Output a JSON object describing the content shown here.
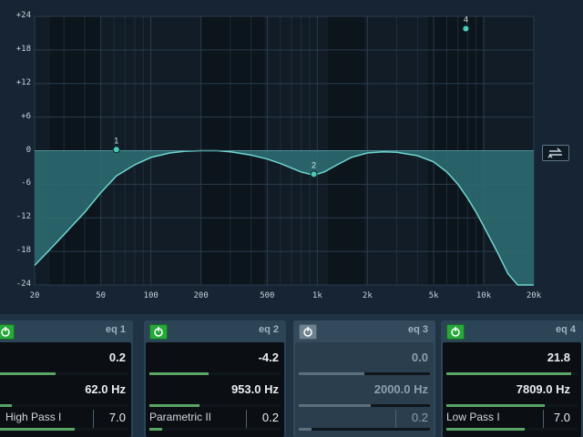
{
  "y_axis_labels": [
    "+24",
    "+18",
    "+12",
    "+6",
    "0",
    "-6",
    "-12",
    "-18",
    "-24"
  ],
  "x_axis_labels": [
    "20",
    "50",
    "100",
    "200",
    "500",
    "1k",
    "2k",
    "5k",
    "10k",
    "20k"
  ],
  "curve_points_db": [
    [
      20,
      -20.5
    ],
    [
      25,
      -17.5
    ],
    [
      30,
      -15
    ],
    [
      40,
      -11
    ],
    [
      50,
      -7.5
    ],
    [
      62,
      -4.5
    ],
    [
      80,
      -2.5
    ],
    [
      100,
      -1.2
    ],
    [
      130,
      -0.4
    ],
    [
      160,
      -0.1
    ],
    [
      200,
      0
    ],
    [
      250,
      0
    ],
    [
      300,
      -0.2
    ],
    [
      400,
      -0.8
    ],
    [
      500,
      -1.5
    ],
    [
      600,
      -2.3
    ],
    [
      700,
      -3.1
    ],
    [
      800,
      -3.8
    ],
    [
      900,
      -4.2
    ],
    [
      953,
      -4.3
    ],
    [
      1000,
      -4.2
    ],
    [
      1100,
      -3.8
    ],
    [
      1300,
      -2.6
    ],
    [
      1600,
      -1.2
    ],
    [
      2000,
      -0.4
    ],
    [
      2500,
      -0.2
    ],
    [
      3000,
      -0.3
    ],
    [
      4000,
      -0.9
    ],
    [
      5000,
      -2
    ],
    [
      6000,
      -3.8
    ],
    [
      7000,
      -6
    ],
    [
      8000,
      -8.5
    ],
    [
      9000,
      -11
    ],
    [
      10000,
      -13.5
    ],
    [
      12000,
      -18
    ],
    [
      14000,
      -22
    ],
    [
      16000,
      -24
    ],
    [
      20000,
      -24
    ]
  ],
  "band_points": [
    {
      "id": "1",
      "freq": 62,
      "gain": 0.2
    },
    {
      "id": "2",
      "freq": 953,
      "gain": -4.2
    },
    {
      "id": "4",
      "freq": 7809,
      "gain": 21.8
    }
  ],
  "bypass_icon": "link-arrows-icon",
  "bands": [
    {
      "name": "eq 1",
      "enabled": true,
      "gain": "0.2",
      "freq": "62.0 Hz",
      "type": "High Pass I",
      "q": "7.0",
      "gain_fill": 0.45,
      "freq_fill": 0.12,
      "q_fill": 0.6
    },
    {
      "name": "eq 2",
      "enabled": true,
      "gain": "-4.2",
      "freq": "953.0 Hz",
      "type": "Parametric II",
      "q": "0.2",
      "gain_fill": 0.45,
      "freq_fill": 0.38,
      "q_fill": 0.1
    },
    {
      "name": "eq 3",
      "enabled": false,
      "gain": "0.0",
      "freq": "2000.0 Hz",
      "type": "",
      "q": "0.2",
      "gain_fill": 0.5,
      "freq_fill": 0.55,
      "q_fill": 0.1
    },
    {
      "name": "eq 4",
      "enabled": true,
      "gain": "21.8",
      "freq": "7809.0 Hz",
      "type": "Low Pass I",
      "q": "7.0",
      "gain_fill": 0.95,
      "freq_fill": 0.75,
      "q_fill": 0.6
    }
  ],
  "colors": {
    "accent": "#26a83a",
    "curve": "#6fd6cf",
    "fill": "#2e6f74",
    "node": "#4fcab8"
  }
}
